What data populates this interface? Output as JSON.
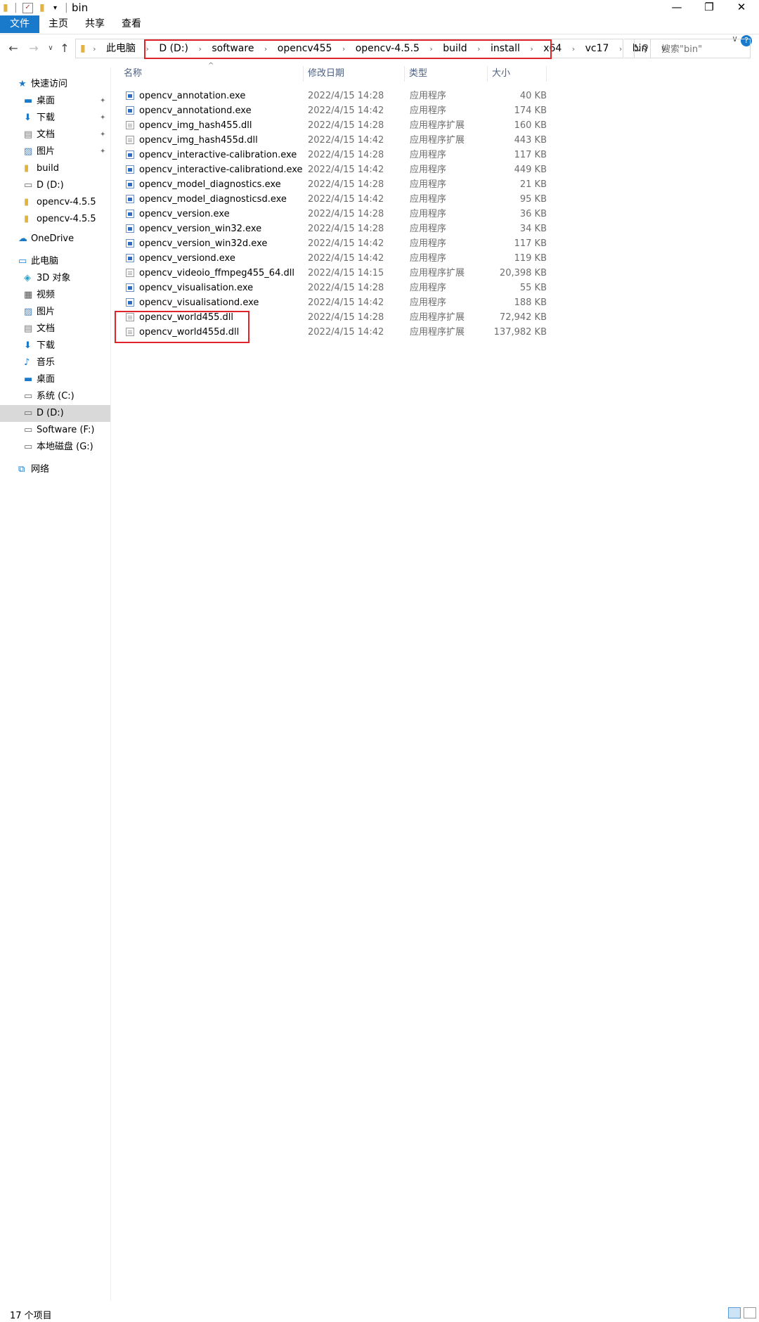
{
  "window": {
    "title": "bin",
    "controls": {
      "minimize": "—",
      "maximize": "❐",
      "close": "✕"
    }
  },
  "ribbon": {
    "tabs": [
      "文件",
      "主页",
      "共享",
      "查看"
    ]
  },
  "address": {
    "root": "此电脑",
    "crumbs": [
      "D (D:)",
      "software",
      "opencv455",
      "opencv-4.5.5",
      "build",
      "install",
      "x64",
      "vc17",
      "bin"
    ]
  },
  "search": {
    "placeholder": "搜索\"bin\""
  },
  "navpane": {
    "quick_access": "快速访问",
    "quick_items": [
      {
        "label": "桌面",
        "icon": "desktop-icon",
        "pinned": true
      },
      {
        "label": "下载",
        "icon": "download-icon",
        "pinned": true
      },
      {
        "label": "文档",
        "icon": "document-icon",
        "pinned": true
      },
      {
        "label": "图片",
        "icon": "picture-icon",
        "pinned": true
      },
      {
        "label": "build",
        "icon": "folder-icon",
        "pinned": false
      },
      {
        "label": "D (D:)",
        "icon": "drive-icon",
        "pinned": false
      },
      {
        "label": "opencv-4.5.5",
        "icon": "folder-icon",
        "pinned": false
      },
      {
        "label": "opencv-4.5.5",
        "icon": "folder-icon",
        "pinned": false
      }
    ],
    "onedrive": "OneDrive",
    "this_pc": "此电脑",
    "pc_items": [
      {
        "label": "3D 对象",
        "icon": "3d-objects-icon"
      },
      {
        "label": "视频",
        "icon": "video-icon"
      },
      {
        "label": "图片",
        "icon": "picture-icon"
      },
      {
        "label": "文档",
        "icon": "document-icon"
      },
      {
        "label": "下载",
        "icon": "download-icon"
      },
      {
        "label": "音乐",
        "icon": "music-icon"
      },
      {
        "label": "桌面",
        "icon": "desktop-icon"
      },
      {
        "label": "系统 (C:)",
        "icon": "drive-icon"
      },
      {
        "label": "D (D:)",
        "icon": "drive-icon"
      },
      {
        "label": "Software (F:)",
        "icon": "drive-icon"
      },
      {
        "label": "本地磁盘 (G:)",
        "icon": "drive-icon"
      }
    ],
    "network": "网络",
    "selected_label": "D (D:)"
  },
  "columns": {
    "name": "名称",
    "date": "修改日期",
    "type": "类型",
    "size": "大小"
  },
  "files": [
    {
      "name": "opencv_annotation.exe",
      "date": "2022/4/15 14:28",
      "type": "应用程序",
      "size": "40 KB",
      "kind": "exe"
    },
    {
      "name": "opencv_annotationd.exe",
      "date": "2022/4/15 14:42",
      "type": "应用程序",
      "size": "174 KB",
      "kind": "exe"
    },
    {
      "name": "opencv_img_hash455.dll",
      "date": "2022/4/15 14:28",
      "type": "应用程序扩展",
      "size": "160 KB",
      "kind": "dll"
    },
    {
      "name": "opencv_img_hash455d.dll",
      "date": "2022/4/15 14:42",
      "type": "应用程序扩展",
      "size": "443 KB",
      "kind": "dll"
    },
    {
      "name": "opencv_interactive-calibration.exe",
      "date": "2022/4/15 14:28",
      "type": "应用程序",
      "size": "117 KB",
      "kind": "exe"
    },
    {
      "name": "opencv_interactive-calibrationd.exe",
      "date": "2022/4/15 14:42",
      "type": "应用程序",
      "size": "449 KB",
      "kind": "exe"
    },
    {
      "name": "opencv_model_diagnostics.exe",
      "date": "2022/4/15 14:28",
      "type": "应用程序",
      "size": "21 KB",
      "kind": "exe"
    },
    {
      "name": "opencv_model_diagnosticsd.exe",
      "date": "2022/4/15 14:42",
      "type": "应用程序",
      "size": "95 KB",
      "kind": "exe"
    },
    {
      "name": "opencv_version.exe",
      "date": "2022/4/15 14:28",
      "type": "应用程序",
      "size": "36 KB",
      "kind": "exe"
    },
    {
      "name": "opencv_version_win32.exe",
      "date": "2022/4/15 14:28",
      "type": "应用程序",
      "size": "34 KB",
      "kind": "exe"
    },
    {
      "name": "opencv_version_win32d.exe",
      "date": "2022/4/15 14:42",
      "type": "应用程序",
      "size": "117 KB",
      "kind": "exe"
    },
    {
      "name": "opencv_versiond.exe",
      "date": "2022/4/15 14:42",
      "type": "应用程序",
      "size": "119 KB",
      "kind": "exe"
    },
    {
      "name": "opencv_videoio_ffmpeg455_64.dll",
      "date": "2022/4/15 14:15",
      "type": "应用程序扩展",
      "size": "20,398 KB",
      "kind": "dll"
    },
    {
      "name": "opencv_visualisation.exe",
      "date": "2022/4/15 14:28",
      "type": "应用程序",
      "size": "55 KB",
      "kind": "exe"
    },
    {
      "name": "opencv_visualisationd.exe",
      "date": "2022/4/15 14:42",
      "type": "应用程序",
      "size": "188 KB",
      "kind": "exe"
    },
    {
      "name": "opencv_world455.dll",
      "date": "2022/4/15 14:28",
      "type": "应用程序扩展",
      "size": "72,942 KB",
      "kind": "dll"
    },
    {
      "name": "opencv_world455d.dll",
      "date": "2022/4/15 14:42",
      "type": "应用程序扩展",
      "size": "137,982 KB",
      "kind": "dll"
    }
  ],
  "status": {
    "count": "17 个项目"
  },
  "colors": {
    "accent": "#1979ca",
    "highlight": "#e0242a",
    "selected": "#d9d9d9"
  }
}
